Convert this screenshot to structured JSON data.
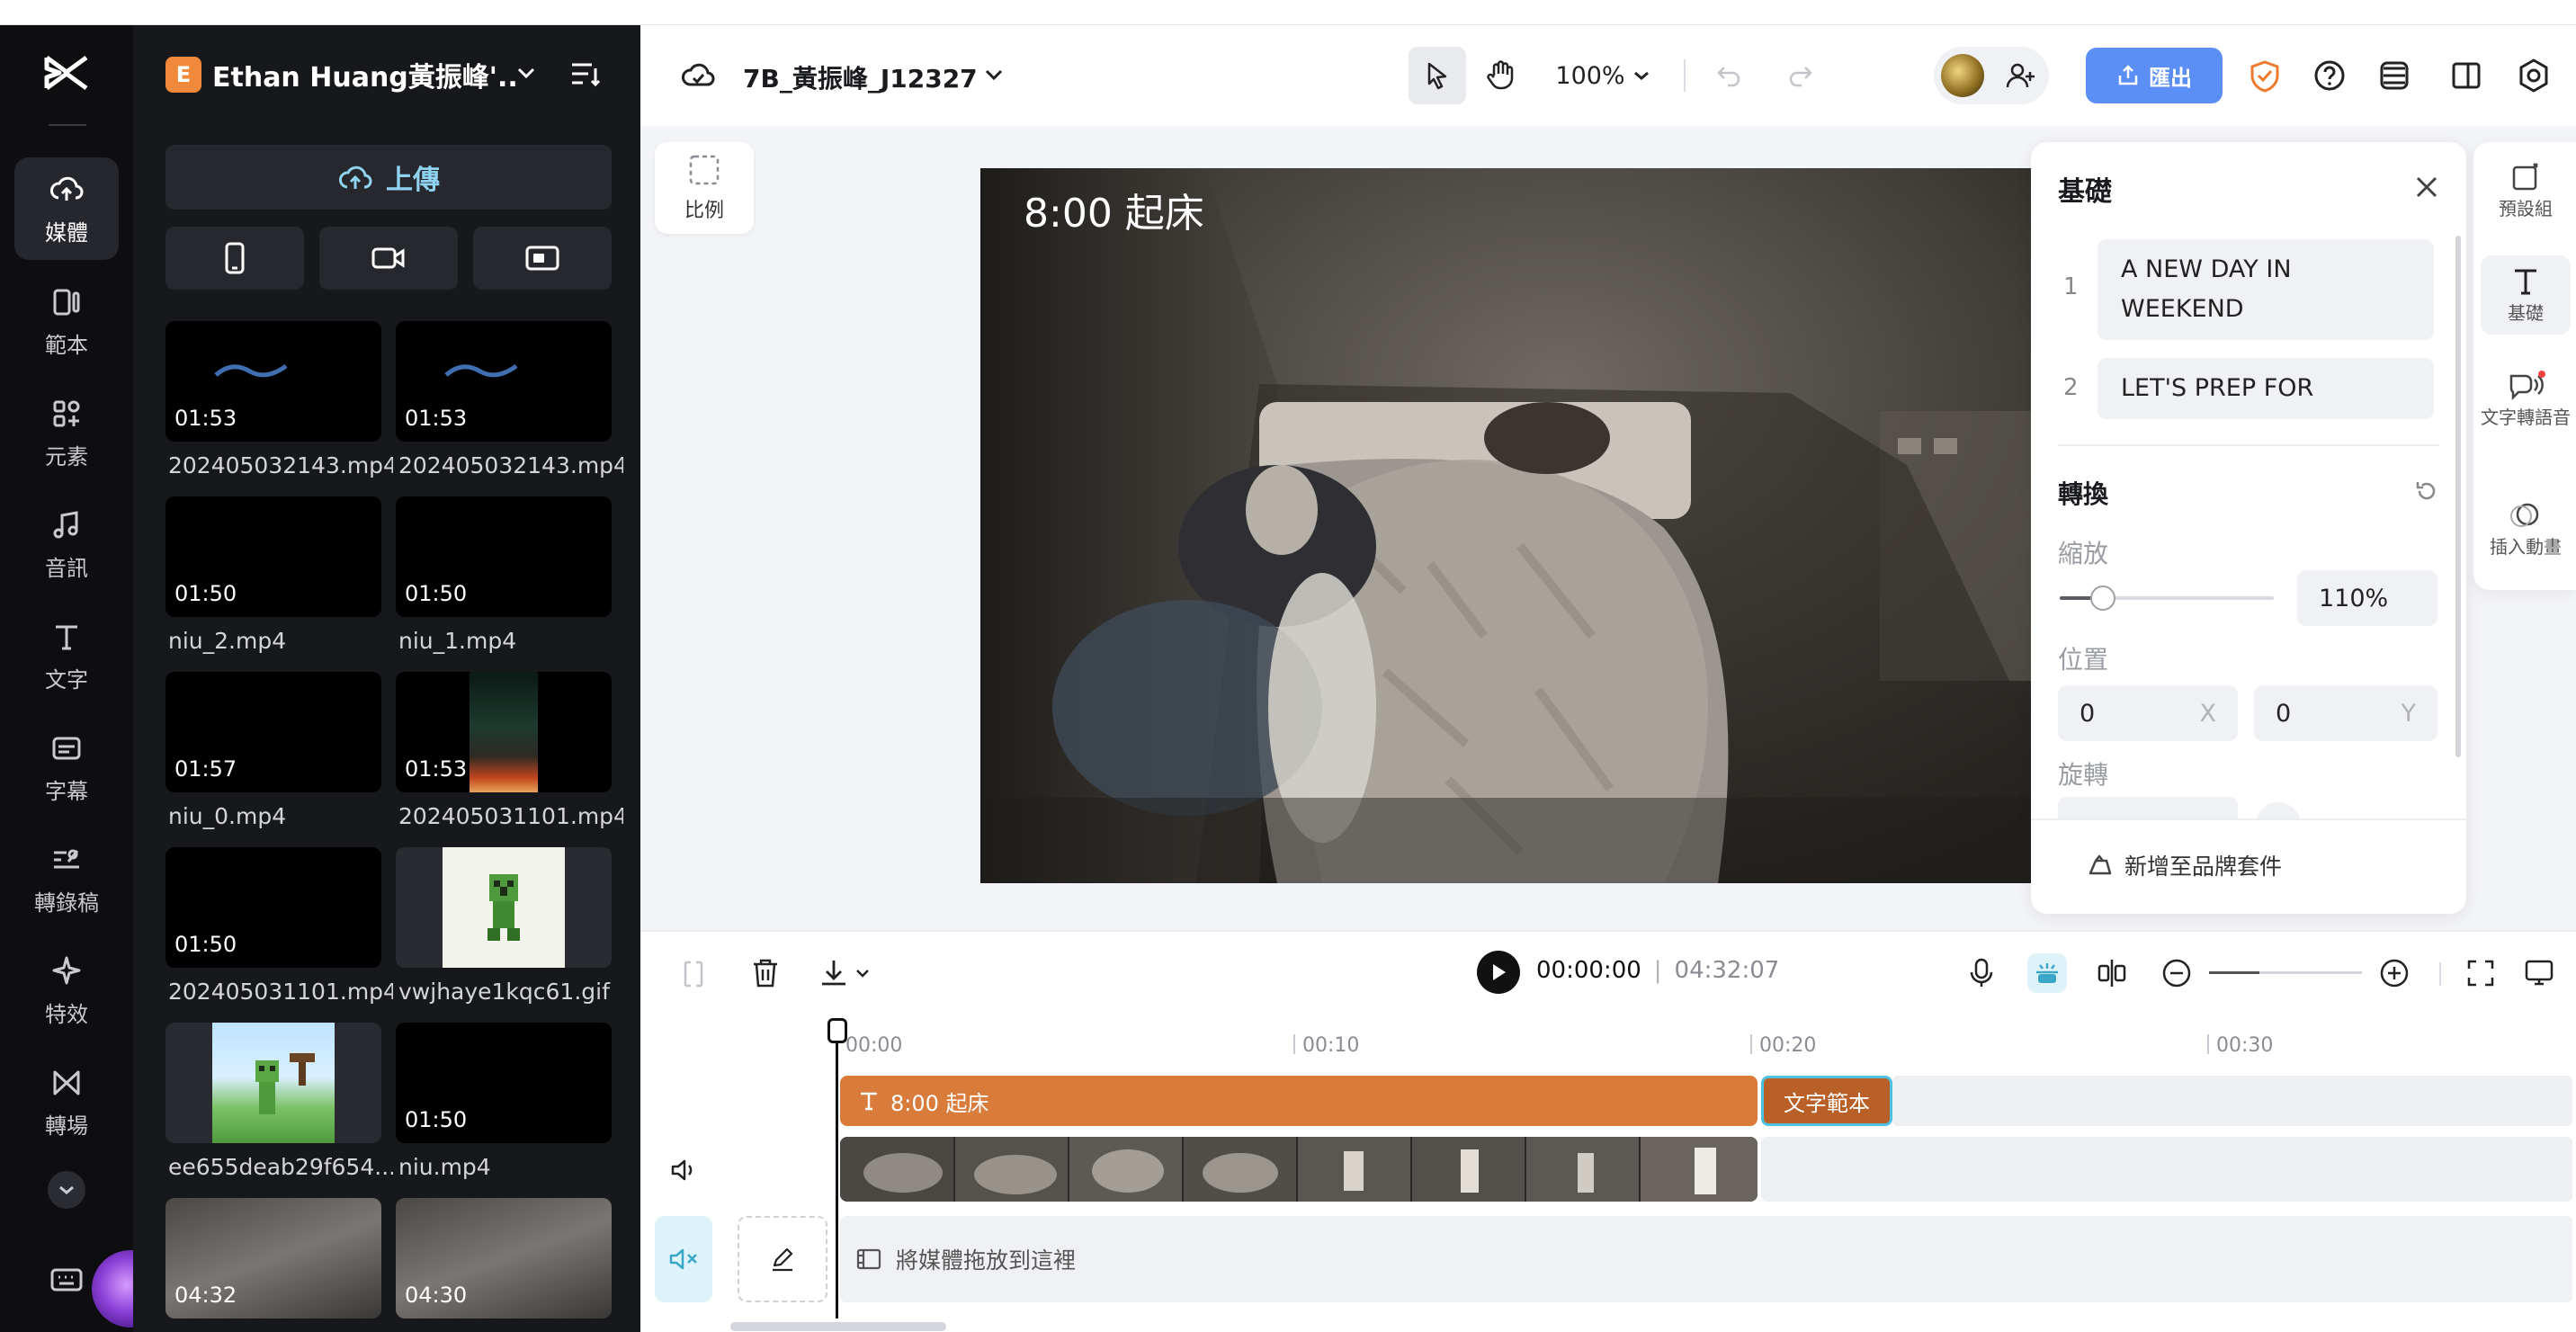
{
  "colors": {
    "accent": "#5b8ff5",
    "clip_orange": "#d97b3a",
    "selection_cyan": "#4ec1e0",
    "nav_bg": "#0e0e10",
    "panel_bg": "#17181b"
  },
  "nav": {
    "items": [
      {
        "label": "媒體",
        "icon": "cloud-upload-icon"
      },
      {
        "label": "範本",
        "icon": "template-icon"
      },
      {
        "label": "元素",
        "icon": "elements-icon"
      },
      {
        "label": "音訊",
        "icon": "music-note-icon"
      },
      {
        "label": "文字",
        "icon": "text-t-icon"
      },
      {
        "label": "字幕",
        "icon": "captions-icon"
      },
      {
        "label": "轉錄稿",
        "icon": "transcript-icon"
      },
      {
        "label": "特效",
        "icon": "sparkle-icon"
      },
      {
        "label": "轉場",
        "icon": "transition-icon"
      }
    ]
  },
  "media_panel": {
    "workspace_badge": "E",
    "workspace_name": "Ethan Huang黃振峰'...",
    "upload_label": "上傳",
    "files": [
      {
        "name": "202405032143.mp4",
        "duration": "01:53"
      },
      {
        "name": "202405032143.mp4",
        "duration": "01:53"
      },
      {
        "name": "niu_2.mp4",
        "duration": "01:50"
      },
      {
        "name": "niu_1.mp4",
        "duration": "01:50"
      },
      {
        "name": "niu_0.mp4",
        "duration": "01:57"
      },
      {
        "name": "202405031101.mp4",
        "duration": "01:53"
      },
      {
        "name": "202405031101.mp4",
        "duration": "01:50"
      },
      {
        "name": "vwjhaye1kqc61.gif",
        "duration": ""
      },
      {
        "name": "ee655deab29f654...",
        "duration": ""
      },
      {
        "name": "niu.mp4",
        "duration": "01:50"
      },
      {
        "name": "",
        "duration": "04:32"
      },
      {
        "name": "",
        "duration": "04:30"
      }
    ]
  },
  "toolbar": {
    "project_name": "7B_黃振峰_J12327",
    "zoom": "100%",
    "export_label": "匯出"
  },
  "canvas": {
    "ratio_label": "比例",
    "overlay_text": "8:00 起床"
  },
  "props": {
    "title": "基礎",
    "text_items": [
      {
        "index": "1",
        "text": "A NEW DAY IN WEEKEND"
      },
      {
        "index": "2",
        "text": "LET'S PREP FOR"
      }
    ],
    "transform_title": "轉換",
    "scale_label": "縮放",
    "scale_value": "110%",
    "scale_fraction": 0.2,
    "position_label": "位置",
    "pos_x": "0",
    "pos_x_suffix": "X",
    "pos_y": "0",
    "pos_y_suffix": "Y",
    "rotate_label": "旋轉",
    "brand_kit_label": "新增至品牌套件"
  },
  "right_rail": {
    "items": [
      {
        "label": "預設組",
        "icon": "preset-icon"
      },
      {
        "label": "基礎",
        "icon": "text-t-icon"
      },
      {
        "label": "文字轉語音",
        "icon": "text-to-speech-icon"
      },
      {
        "label": "插入動畫",
        "icon": "animation-icon"
      }
    ]
  },
  "playback": {
    "current_time": "00:00:00",
    "separator": "|",
    "total_time": "04:32:07"
  },
  "timeline": {
    "ticks": [
      "00:00",
      "00:10",
      "00:20",
      "00:30"
    ],
    "text_clip_label": "8:00 起床",
    "template_clip_label": "文字範本",
    "drop_zone_label": "將媒體拖放到這裡"
  }
}
